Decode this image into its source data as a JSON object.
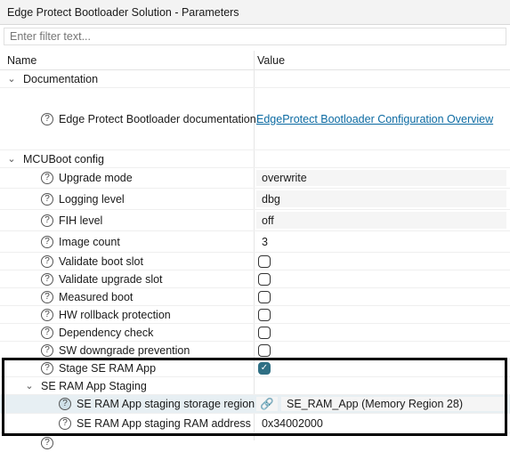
{
  "window": {
    "title": "Edge Protect Bootloader Solution - Parameters"
  },
  "filter": {
    "placeholder": "Enter filter text..."
  },
  "columns": {
    "name": "Name",
    "value": "Value"
  },
  "icons": {
    "collapse": "chevron-down-icon",
    "expand": "chevron-right-icon",
    "help": "help-circle-icon",
    "link": "link-icon"
  },
  "documentation": {
    "label": "Documentation",
    "item_label": "Edge Protect Bootloader documentation",
    "item_value": "EdgeProtect Bootloader Configuration Overview"
  },
  "mcuboot": {
    "label": "MCUBoot config",
    "upgrade_mode": {
      "label": "Upgrade mode",
      "value": "overwrite"
    },
    "logging_level": {
      "label": "Logging level",
      "value": "dbg"
    },
    "fih_level": {
      "label": "FIH level",
      "value": "off"
    },
    "image_count": {
      "label": "Image count",
      "value": "3"
    },
    "validate_boot_slot": {
      "label": "Validate boot slot",
      "checked": false
    },
    "validate_upgrade_slot": {
      "label": "Validate upgrade slot",
      "checked": false
    },
    "measured_boot": {
      "label": "Measured boot",
      "checked": false
    },
    "hw_rollback": {
      "label": "HW rollback protection",
      "checked": false
    },
    "dependency_check": {
      "label": "Dependency check",
      "checked": false
    },
    "sw_downgrade": {
      "label": "SW downgrade prevention",
      "checked": false
    },
    "stage_se_ram": {
      "label": "Stage SE RAM App",
      "checked": true,
      "check_glyph": "✓"
    }
  },
  "se_ram_staging": {
    "label": "SE RAM App Staging",
    "storage_region": {
      "label": "SE RAM App staging storage region",
      "value": "SE_RAM_App (Memory Region 28)"
    },
    "ram_address": {
      "label": "SE RAM App staging RAM address",
      "value": "0x34002000"
    }
  },
  "colors": {
    "accent": "#2f6f84",
    "link": "#0b6aa2",
    "highlight_border": "#000000"
  }
}
